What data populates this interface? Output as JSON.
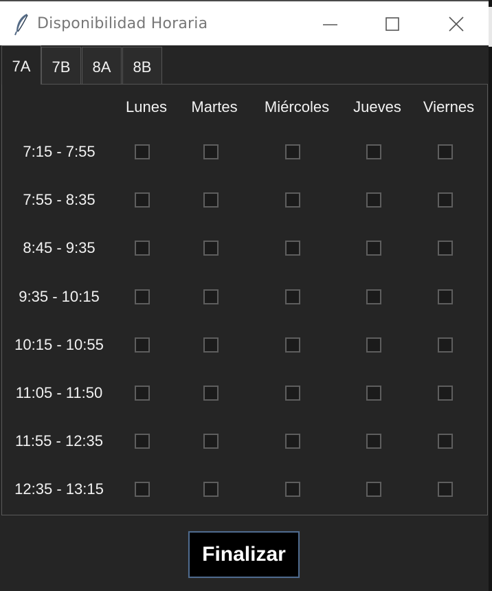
{
  "window": {
    "title": "Disponibilidad Horaria",
    "icon": "feather-icon",
    "controls": [
      "minimize-icon",
      "maximize-icon",
      "close-icon"
    ]
  },
  "tabs": [
    {
      "label": "7A",
      "active": true
    },
    {
      "label": "7B",
      "active": false
    },
    {
      "label": "8A",
      "active": false
    },
    {
      "label": "8B",
      "active": false
    }
  ],
  "grid": {
    "days": [
      "Lunes",
      "Martes",
      "Miércoles",
      "Jueves",
      "Viernes"
    ],
    "slots": [
      "7:15 - 7:55",
      "7:55 - 8:35",
      "8:45 - 9:35",
      "9:35 - 10:15",
      "10:15 - 10:55",
      "11:05 - 11:50",
      "11:55 - 12:35",
      "12:35 - 13:15"
    ],
    "checked": [
      [
        false,
        false,
        false,
        false,
        false
      ],
      [
        false,
        false,
        false,
        false,
        false
      ],
      [
        false,
        false,
        false,
        false,
        false
      ],
      [
        false,
        false,
        false,
        false,
        false
      ],
      [
        false,
        false,
        false,
        false,
        false
      ],
      [
        false,
        false,
        false,
        false,
        false
      ],
      [
        false,
        false,
        false,
        false,
        false
      ],
      [
        false,
        false,
        false,
        false,
        false
      ]
    ]
  },
  "actions": {
    "finalize_label": "Finalizar"
  },
  "colors": {
    "background": "#252525",
    "text": "#f2f2f2",
    "button_border": "#4f6b8f"
  }
}
